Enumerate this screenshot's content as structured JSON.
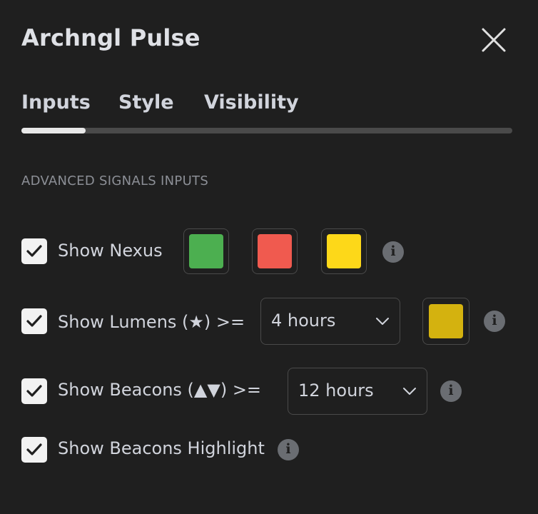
{
  "dialog": {
    "title": "Archngl Pulse"
  },
  "tabs": [
    {
      "label": "Inputs",
      "active": true
    },
    {
      "label": "Style",
      "active": false
    },
    {
      "label": "Visibility",
      "active": false
    }
  ],
  "section": {
    "title": "ADVANCED SIGNALS INPUTS"
  },
  "rows": {
    "nexus": {
      "label": "Show Nexus",
      "checked": true,
      "colors": [
        "#4caf50",
        "#f05a4f",
        "#fdd819"
      ]
    },
    "lumens": {
      "label": "Show Lumens (★) >=",
      "checked": true,
      "select_value": "4 hours",
      "color": "#d4b20f"
    },
    "beacons": {
      "label": "Show Beacons (▲▼) >=",
      "checked": true,
      "select_value": "12 hours"
    },
    "highlight": {
      "label": "Show Beacons Highlight",
      "checked": true
    }
  },
  "icons": {
    "close": "close-icon",
    "check": "check-icon",
    "info": "info-icon",
    "chevron": "chevron-down-icon"
  },
  "info_glyph": "i"
}
